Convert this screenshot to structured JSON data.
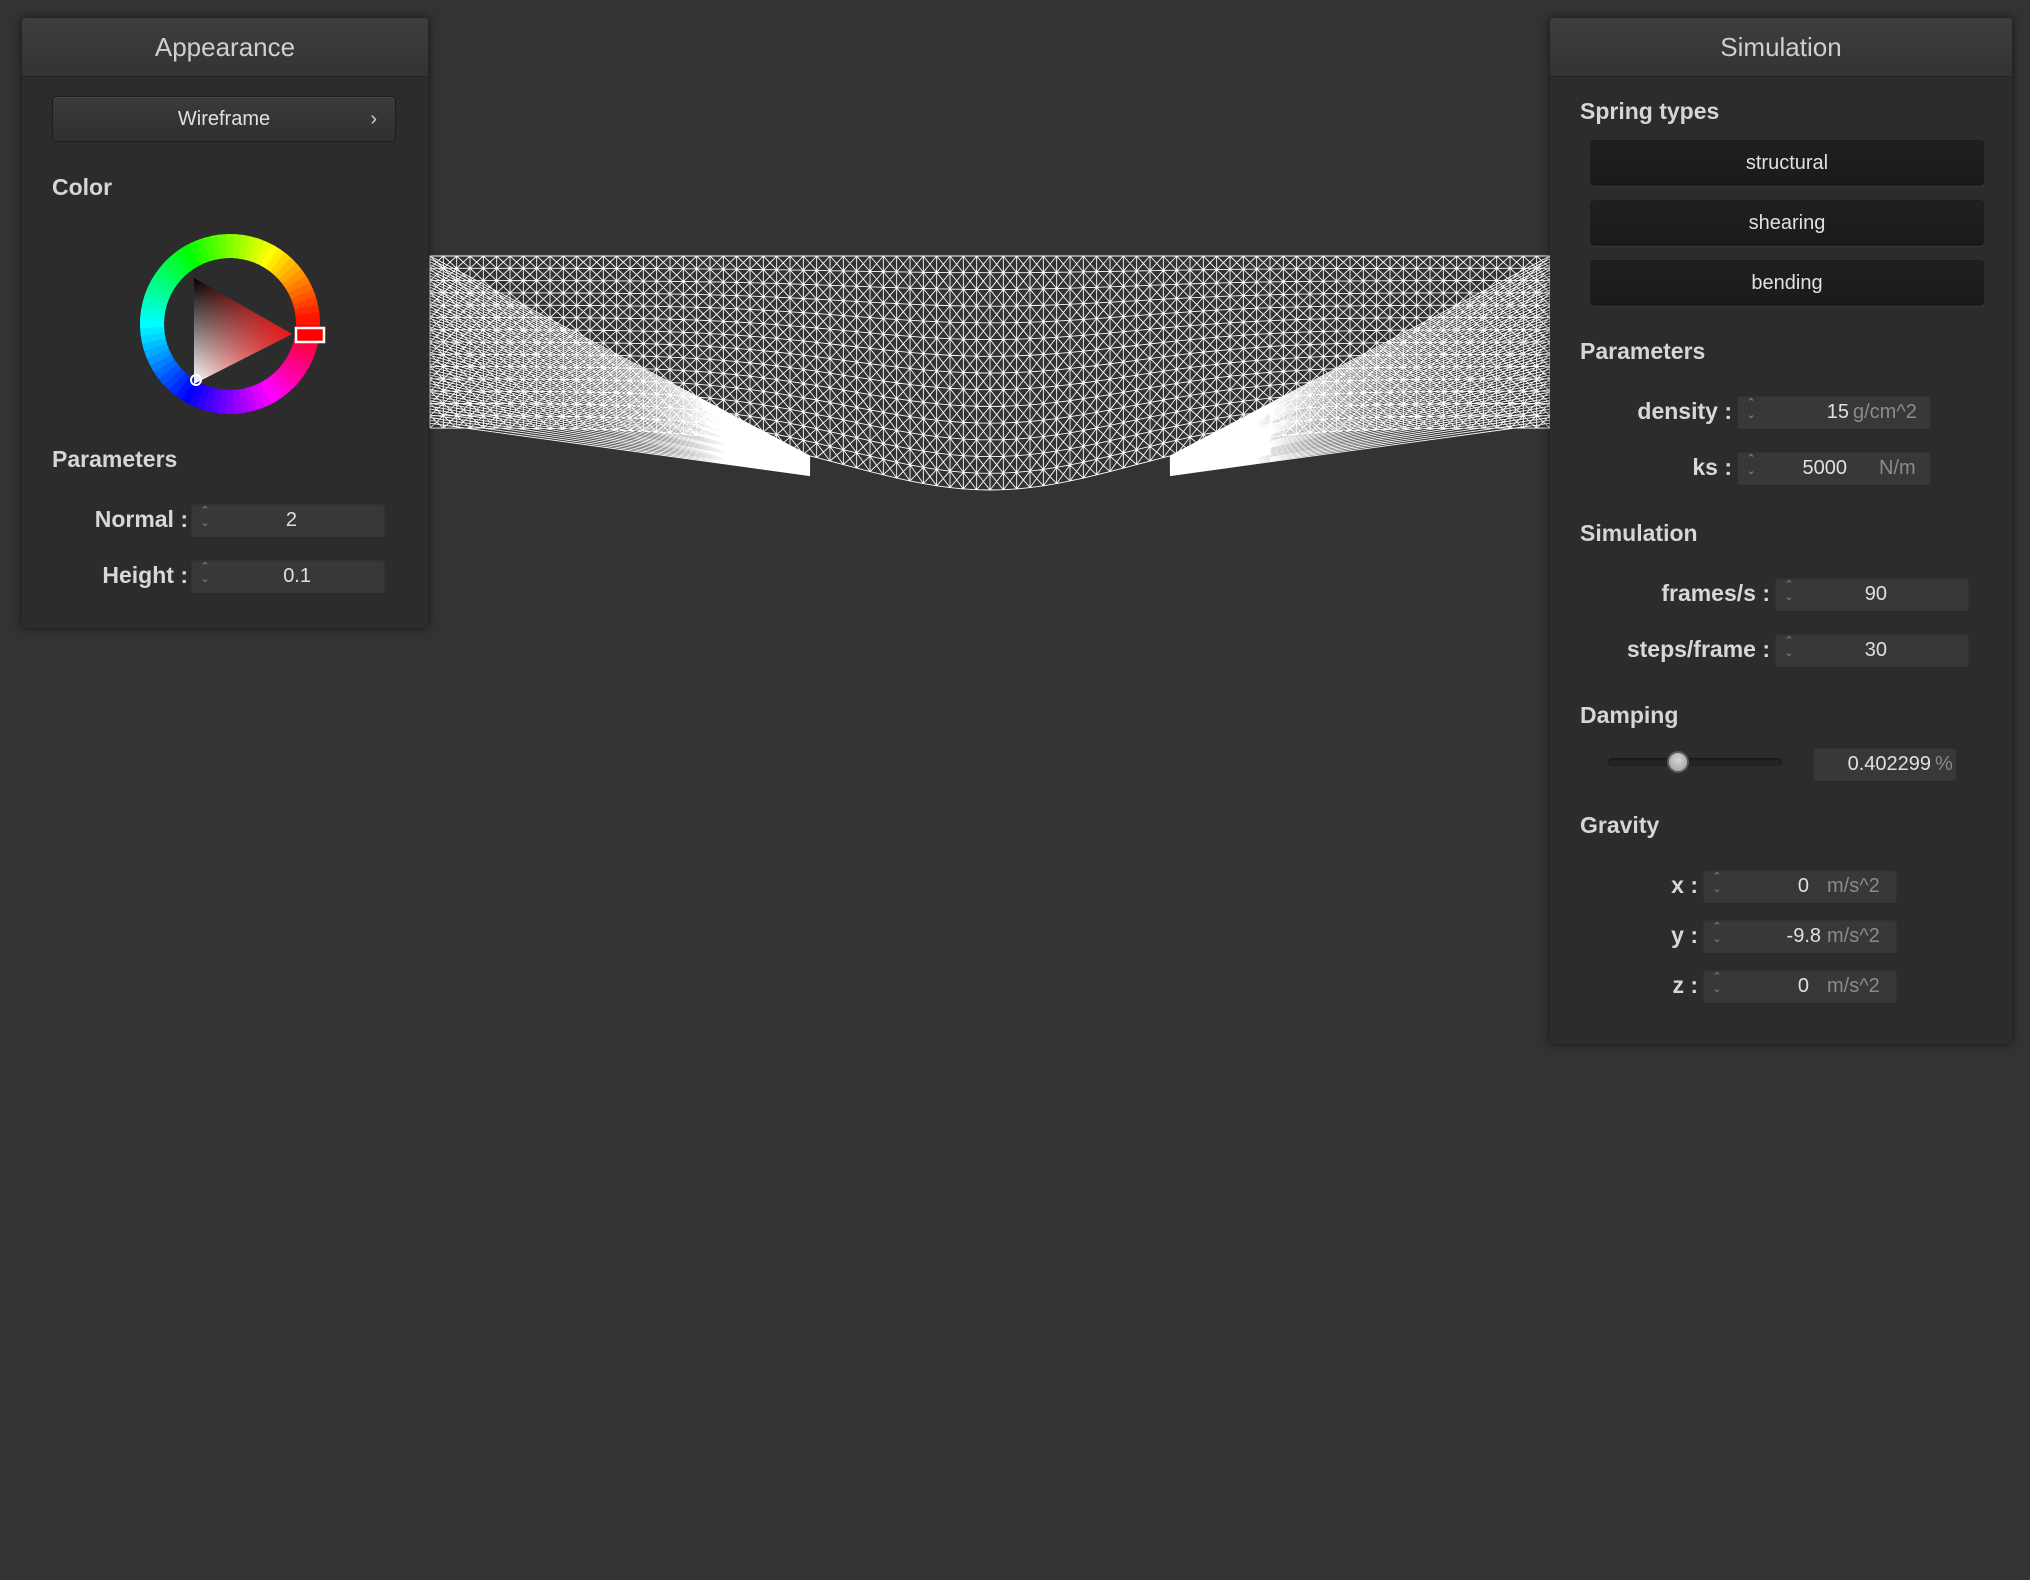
{
  "appearance": {
    "title": "Appearance",
    "mode_button": "Wireframe",
    "chevron": "›",
    "color_label": "Color",
    "color": "#ff0000",
    "params_label": "Parameters",
    "normal_label": "Normal :",
    "normal_value": "2",
    "height_label": "Height :",
    "height_value": "0.1"
  },
  "simulation": {
    "title": "Simulation",
    "spring_types_label": "Spring types",
    "spring_types": [
      "structural",
      "shearing",
      "bending"
    ],
    "params_label": "Parameters",
    "density_label": "density :",
    "density_value": "15",
    "density_unit": "g/cm^2",
    "ks_label": "ks :",
    "ks_value": "5000",
    "ks_unit": "N/m",
    "sim_label": "Simulation",
    "fps_label": "frames/s :",
    "fps_value": "90",
    "steps_label": "steps/frame :",
    "steps_value": "30",
    "damping_label": "Damping",
    "damping_value": "0.402299",
    "damping_unit": "%",
    "damping_fraction": 0.4,
    "gravity_label": "Gravity",
    "gx_label": "x :",
    "gx_value": "0",
    "gy_label": "y :",
    "gy_value": "-9.8",
    "gz_label": "z :",
    "gz_value": "0",
    "gravity_unit": "m/s^2"
  },
  "spin_up": "⌃",
  "spin_down": "⌄",
  "colors": {
    "background": "#333333",
    "panel": "#2c2c2c",
    "wire": "#ffffff"
  }
}
